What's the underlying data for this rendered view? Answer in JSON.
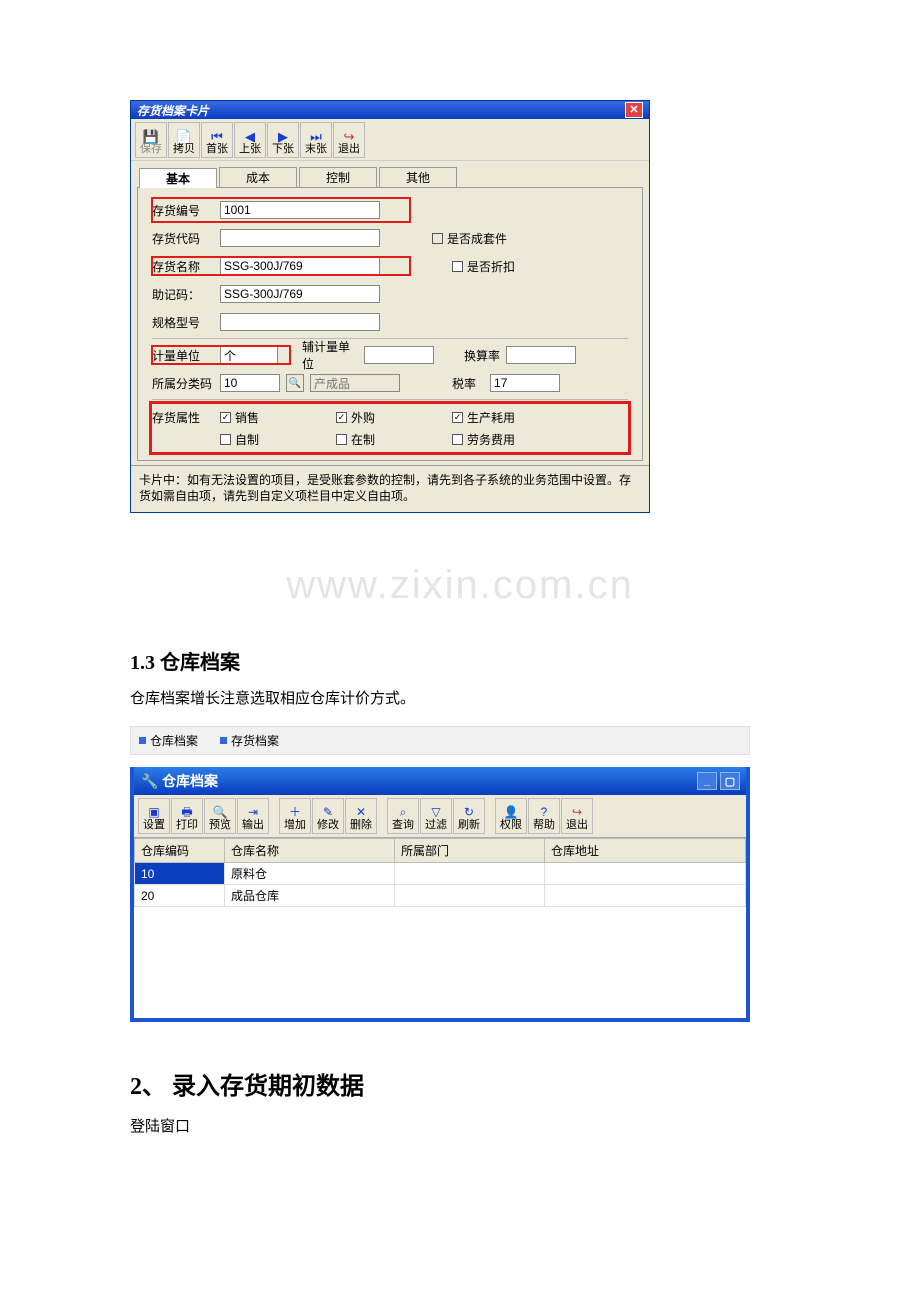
{
  "window1": {
    "title": "存货档案卡片",
    "toolbar": [
      {
        "label": "保存",
        "icon": "save",
        "disabled": true
      },
      {
        "label": "拷贝",
        "icon": "copy"
      },
      {
        "label": "首张",
        "icon": "first"
      },
      {
        "label": "上张",
        "icon": "prev"
      },
      {
        "label": "下张",
        "icon": "next"
      },
      {
        "label": "末张",
        "icon": "last"
      },
      {
        "label": "退出",
        "icon": "exit"
      }
    ],
    "tabs": [
      "基本",
      "成本",
      "控制",
      "其他"
    ],
    "active_tab": "基本",
    "fields": {
      "inv_no_label": "存货编号",
      "inv_no": "1001",
      "inv_code_label": "存货代码",
      "inv_code": "",
      "is_kit_label": "是否成套件",
      "inv_name_label": "存货名称",
      "inv_name": "SSG-300J/769",
      "is_discount_label": "是否折扣",
      "mnemonic_label": "助记码：",
      "mnemonic": "SSG-300J/769",
      "spec_label": "规格型号",
      "spec": "",
      "uom_label": "计量单位",
      "uom": "个",
      "aux_uom_label": "辅计量单位",
      "aux_uom": "",
      "rate_label": "换算率",
      "rate": "",
      "cat_code_label": "所属分类码",
      "cat_code": "10",
      "cat_name": "产成品",
      "tax_label": "税率",
      "tax": "17",
      "attr_label": "存货属性",
      "attr_sale": "销售",
      "attr_purchase": "外购",
      "attr_prod": "生产耗用",
      "attr_self": "自制",
      "attr_inprog": "在制",
      "attr_labor": "劳务费用"
    },
    "help": "卡片中：如有无法设置的项目，是受账套参数的控制，请先到各子系统的业务范围中设置。存货如需自由项，请先到自定义项栏目中定义自由项。"
  },
  "watermark": "www.zixin.com.cn",
  "section1": {
    "title": "1.3 仓库档案",
    "body": "仓库档案增长注意选取相应仓库计价方式。"
  },
  "breadcrumb": [
    "仓库档案",
    "存货档案"
  ],
  "window2": {
    "title": "仓库档案",
    "toolbar": [
      {
        "label": "设置"
      },
      {
        "label": "打印"
      },
      {
        "label": "预览"
      },
      {
        "label": "输出"
      },
      {
        "gap": true
      },
      {
        "label": "增加"
      },
      {
        "label": "修改"
      },
      {
        "label": "删除"
      },
      {
        "gap": true
      },
      {
        "label": "查询"
      },
      {
        "label": "过滤"
      },
      {
        "label": "刷新"
      },
      {
        "gap": true
      },
      {
        "label": "权限"
      },
      {
        "label": "帮助"
      },
      {
        "label": "退出"
      }
    ],
    "columns": [
      "仓库编码",
      "仓库名称",
      "所属部门",
      "仓库地址"
    ],
    "rows": [
      {
        "code": "10",
        "name": "原料仓",
        "dept": "",
        "addr": ""
      },
      {
        "code": "20",
        "name": "成品仓库",
        "dept": "",
        "addr": ""
      }
    ]
  },
  "section2": {
    "title": "2、  录入存货期初数据",
    "body": "登陆窗口"
  }
}
